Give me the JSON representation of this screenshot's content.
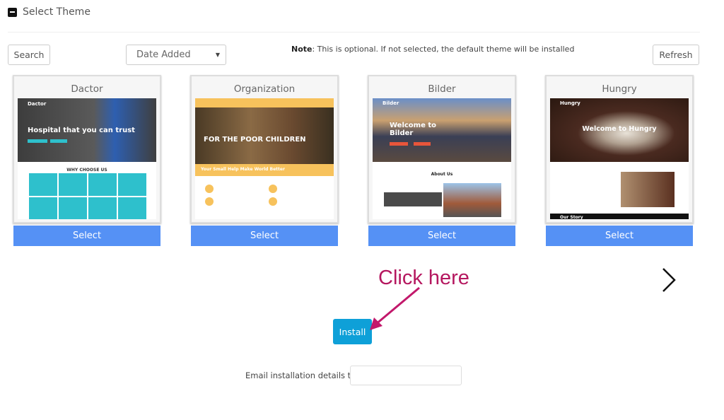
{
  "section": {
    "title": "Select Theme",
    "icon": "collapse-minus-icon"
  },
  "toolbar": {
    "search_label": "Search",
    "sort_value": "Date Added",
    "note_label": "Note",
    "note_text": ": This is optional. If not selected, the default theme will be installed",
    "refresh_label": "Refresh"
  },
  "themes": [
    {
      "name": "Dactor",
      "logo": "Dactor",
      "headline": "Hospital that you can trust",
      "section": "WHY CHOOSE US",
      "select_label": "Select"
    },
    {
      "name": "Organization",
      "headline": "FOR THE POOR CHILDREN",
      "banner": "Your Small Help Make World Better",
      "select_label": "Select"
    },
    {
      "name": "Bilder",
      "logo": "Bilder",
      "headline": "Welcome to Bilder",
      "section": "About Us",
      "select_label": "Select"
    },
    {
      "name": "Hungry",
      "logo": "Hungry",
      "headline": "Welcome to Hungry",
      "section": "Our Story",
      "select_label": "Select"
    }
  ],
  "annotation": {
    "text": "Click here",
    "color": "#b5175f"
  },
  "install_label": "Install",
  "email": {
    "label": "Email installation details to :",
    "value": ""
  },
  "colors": {
    "select": "#5591f5",
    "install": "#0ea0d8"
  }
}
